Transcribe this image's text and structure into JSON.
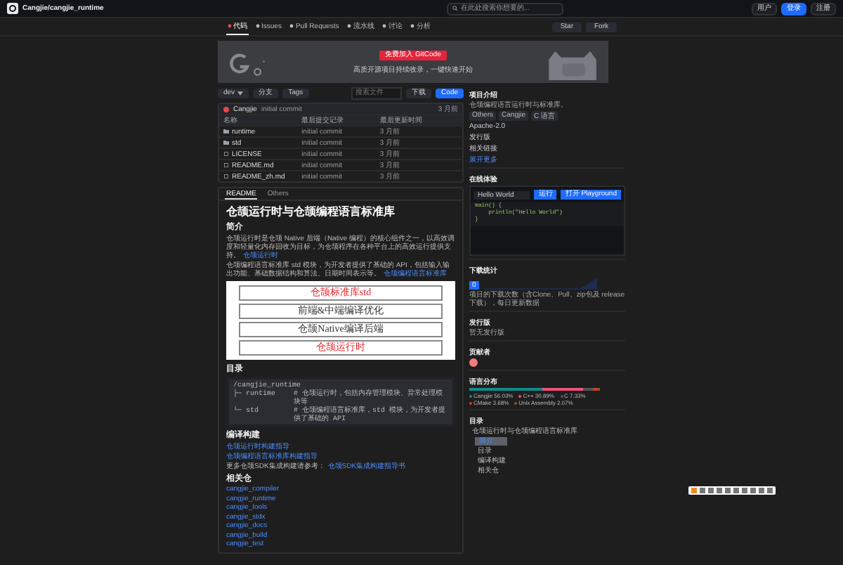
{
  "topbar": {
    "repo": "Cangjie/cangjie_runtime",
    "search": {
      "placeholder": "在此处搜索你想要的..."
    },
    "actions": [
      {
        "label": "用户",
        "kind": "plain"
      },
      {
        "label": "登录",
        "kind": "primary"
      },
      {
        "label": "注册",
        "kind": "plain"
      }
    ]
  },
  "tabs": [
    {
      "label": "代码",
      "selected": true
    },
    {
      "label": "Issues",
      "selected": false
    },
    {
      "label": "Pull Requests",
      "selected": false
    },
    {
      "label": "流水线",
      "selected": false
    },
    {
      "label": "讨论",
      "selected": false
    },
    {
      "label": "分析",
      "selected": false
    }
  ],
  "repo_actions": [
    {
      "label": "Star"
    },
    {
      "label": "Fork"
    }
  ],
  "banner": {
    "button": "免费加入 GitCode",
    "text": "高质开源项目持续收录，一键快速开始"
  },
  "toolbar": {
    "branch": "dev",
    "branches": "分支",
    "tags": "Tags",
    "search": {
      "placeholder": "搜索文件"
    },
    "buttons": [
      {
        "label": "下载",
        "kind": "plain"
      },
      {
        "label": "Code",
        "kind": "primary"
      }
    ]
  },
  "commit": {
    "author": "Cangjie",
    "message": "initial commit",
    "time": "3 月前"
  },
  "files": {
    "columns": [
      "名称",
      "最后提交记录",
      "最后更新时间"
    ],
    "rows": [
      {
        "name": "runtime",
        "kind": "folder",
        "message": "initial commit",
        "time": "3 月前"
      },
      {
        "name": "std",
        "kind": "folder",
        "message": "initial commit",
        "time": "3 月前"
      },
      {
        "name": "LICENSE",
        "kind": "file",
        "message": "initial commit",
        "time": "3 月前"
      },
      {
        "name": "README.md",
        "kind": "file",
        "message": "initial commit",
        "time": "3 月前"
      },
      {
        "name": "README_zh.md",
        "kind": "file",
        "message": "initial commit",
        "time": "3 月前"
      }
    ]
  },
  "readme_tabs": [
    {
      "label": "README",
      "selected": true
    },
    {
      "label": "Others",
      "selected": false
    }
  ],
  "readme": {
    "title": "仓颉运行时与仓颉编程语言标准库",
    "intro_heading": "简介",
    "paragraphs": [
      {
        "text": "仓颉运行时是仓颉 Native 后端（Native 编程）的核心组件之一，以高效调度和轻量化内存回收为目标，为仓颉程序在各种平台上的高效运行提供支持。",
        "link": "仓颉运行时"
      },
      {
        "text": "仓颉编程语言标准库 std 模块，为开发者提供了基础的 API，包括输入输出功能、基础数据结构和算法、日期时间表示等。",
        "link": "仓颉编程语言标准库"
      }
    ],
    "diagram": [
      {
        "label": "仓颉标准库std",
        "highlight": true
      },
      {
        "label": "前端&中端编译优化",
        "highlight": false
      },
      {
        "label": "仓颉Native编译后端",
        "highlight": false
      },
      {
        "label": "仓颉运行时",
        "highlight": true
      }
    ],
    "toc_heading": "目录",
    "tree": [
      {
        "path": "/cangjie_runtime"
      },
      {
        "path": "├─ runtime",
        "note": "# 仓颉运行时，包括内存管理模块、异常处理模块等"
      },
      {
        "path": "└─ std",
        "note": "# 仓颉编程语言标准库，std 模块，为开发者提供了基础的 API"
      }
    ],
    "build_heading": "编译构建",
    "build_links": [
      "仓颉运行时构建指导",
      "仓颉编程语言标准库构建指导"
    ],
    "build_note": {
      "text": "更多仓颉SDK集成构建请参考：",
      "link": "仓颉SDK集成构建指导书"
    },
    "related_heading": "相关仓",
    "related": [
      "cangjie_compiler",
      "cangjie_runtime",
      "cangjie_tools",
      "cangjie_stdx",
      "cangjie_docs",
      "cangjie_build",
      "cangjie_test"
    ]
  },
  "sidebar": {
    "about": {
      "heading": "项目介绍",
      "description": "仓颉编程语言运行时与标准库。",
      "tags": [
        "Others",
        "Cangjie",
        "C 语言"
      ],
      "license": "Apache-2.0",
      "items": [
        "发行版",
        "相关链接"
      ],
      "more": "展开更多"
    },
    "playground": {
      "heading": "在线体验",
      "select": "Hello World",
      "buttons": [
        "运行",
        "打开 Playground"
      ],
      "code": [
        "main() {",
        "    println(\"Hello World\")",
        "}"
      ]
    },
    "downloads": {
      "heading": "下载统计",
      "badge": "0",
      "note": "项目的下载次数（含Clone、Pull、zip包及 release 下载），每日更新数据"
    },
    "releases": {
      "heading": "发行版",
      "text": "暂无发行版"
    },
    "contributors": {
      "heading": "贡献者"
    },
    "languages": {
      "heading": "语言分布",
      "items": [
        {
          "name": "Cangjie",
          "percent": "56.03%",
          "color": "#0f8c8c"
        },
        {
          "name": "C++",
          "percent": "30.89%",
          "color": "#f0507a"
        },
        {
          "name": "C",
          "percent": "7.33%",
          "color": "#555555"
        },
        {
          "name": "CMake",
          "percent": "3.68%",
          "color": "#da3434"
        },
        {
          "name": "Unix Assembly",
          "percent": "2.07%",
          "color": "#8a5a00"
        }
      ]
    },
    "outline": {
      "heading": "目录",
      "items": [
        {
          "label": "仓颉运行时与仓颉编程语言标准库",
          "selected": false,
          "children": [
            {
              "label": "简介",
              "selected": true
            },
            {
              "label": "目录",
              "selected": false
            },
            {
              "label": "编译构建",
              "selected": false
            },
            {
              "label": "相关仓",
              "selected": false
            }
          ]
        }
      ]
    }
  }
}
